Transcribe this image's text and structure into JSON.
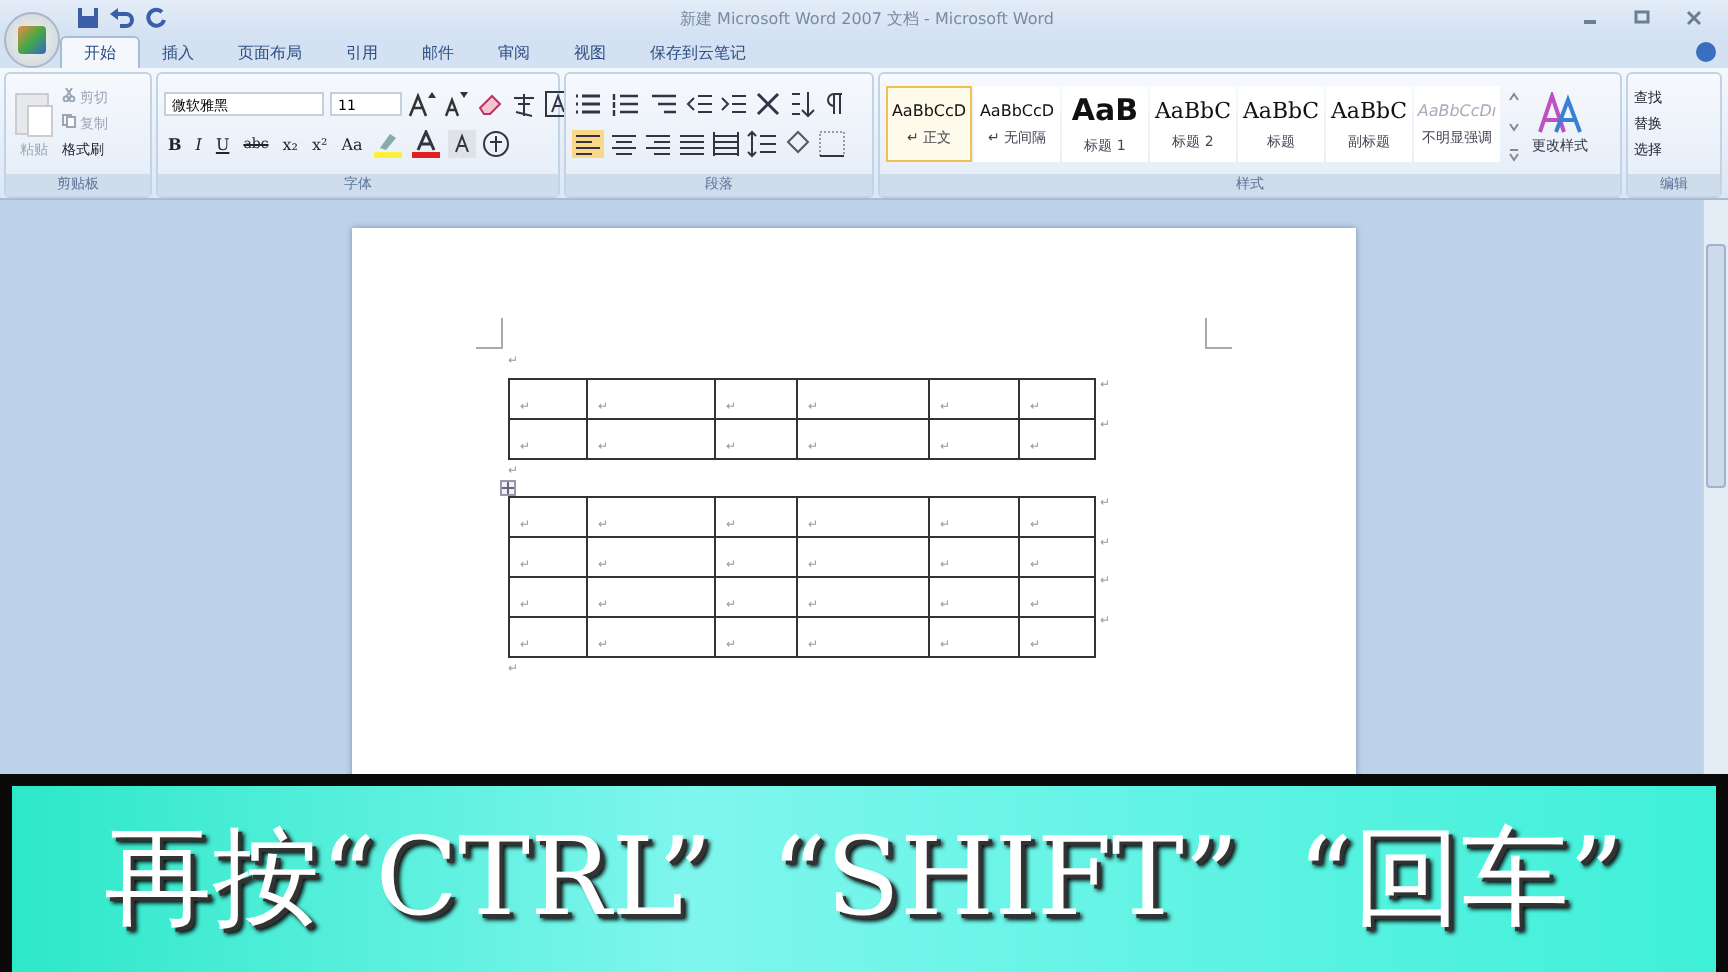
{
  "window": {
    "title": "新建 Microsoft Word 2007 文档 - Microsoft Word"
  },
  "tabs": [
    {
      "label": "开始",
      "selected": true
    },
    {
      "label": "插入",
      "selected": false
    },
    {
      "label": "页面布局",
      "selected": false
    },
    {
      "label": "引用",
      "selected": false
    },
    {
      "label": "邮件",
      "selected": false
    },
    {
      "label": "审阅",
      "selected": false
    },
    {
      "label": "视图",
      "selected": false
    },
    {
      "label": "保存到云笔记",
      "selected": false
    }
  ],
  "clipboard": {
    "title": "剪贴板",
    "paste": "粘贴",
    "cut": "剪切",
    "copy": "复制",
    "format_painter": "格式刷"
  },
  "font": {
    "title": "字体",
    "font_name": "微软雅黑",
    "font_size": "11",
    "format_buttons": [
      "B",
      "I",
      "U",
      "abc",
      "x₂",
      "x²",
      "Aa"
    ]
  },
  "paragraph": {
    "title": "段落"
  },
  "styles": {
    "title": "样式",
    "change_styles": "更改样式",
    "items": [
      {
        "sample": "AaBbCcD",
        "label": "↵ 正文",
        "kind": "normal",
        "selected": true
      },
      {
        "sample": "AaBbCcD",
        "label": "↵ 无间隔",
        "kind": "normal",
        "selected": false
      },
      {
        "sample": "AaB",
        "label": "标题 1",
        "kind": "heading1",
        "selected": false
      },
      {
        "sample": "AaBbC",
        "label": "标题 2",
        "kind": "heading2",
        "selected": false
      },
      {
        "sample": "AaBbC",
        "label": "标题",
        "kind": "heading2",
        "selected": false
      },
      {
        "sample": "AaBbC",
        "label": "副标题",
        "kind": "heading2",
        "selected": false
      },
      {
        "sample": "AaBbCcDı",
        "label": "不明显强调",
        "kind": "subtle",
        "selected": false
      }
    ]
  },
  "editing": {
    "title": "编辑",
    "find": "查找",
    "replace": "替换",
    "select": "选择"
  },
  "document": {
    "paragraph_mark": "↵",
    "tables": [
      {
        "rows": [
          [
            "↵",
            "↵",
            "↵",
            "↵",
            "↵",
            "↵"
          ],
          [
            "↵",
            "↵",
            "↵",
            "↵",
            "↵",
            "↵"
          ]
        ]
      },
      {
        "rows": [
          [
            "↵",
            "↵",
            "↵",
            "↵",
            "↵",
            "↵"
          ],
          [
            "↵",
            "↵",
            "↵",
            "↵",
            "↵",
            "↵"
          ],
          [
            "↵",
            "↵",
            "↵",
            "↵",
            "↵",
            "↵"
          ],
          [
            "↵",
            "↵",
            "↵",
            "↵",
            "↵",
            "↵"
          ]
        ]
      }
    ]
  },
  "caption": {
    "text": "再按“CTRL” “SHIFT” “回车”"
  }
}
